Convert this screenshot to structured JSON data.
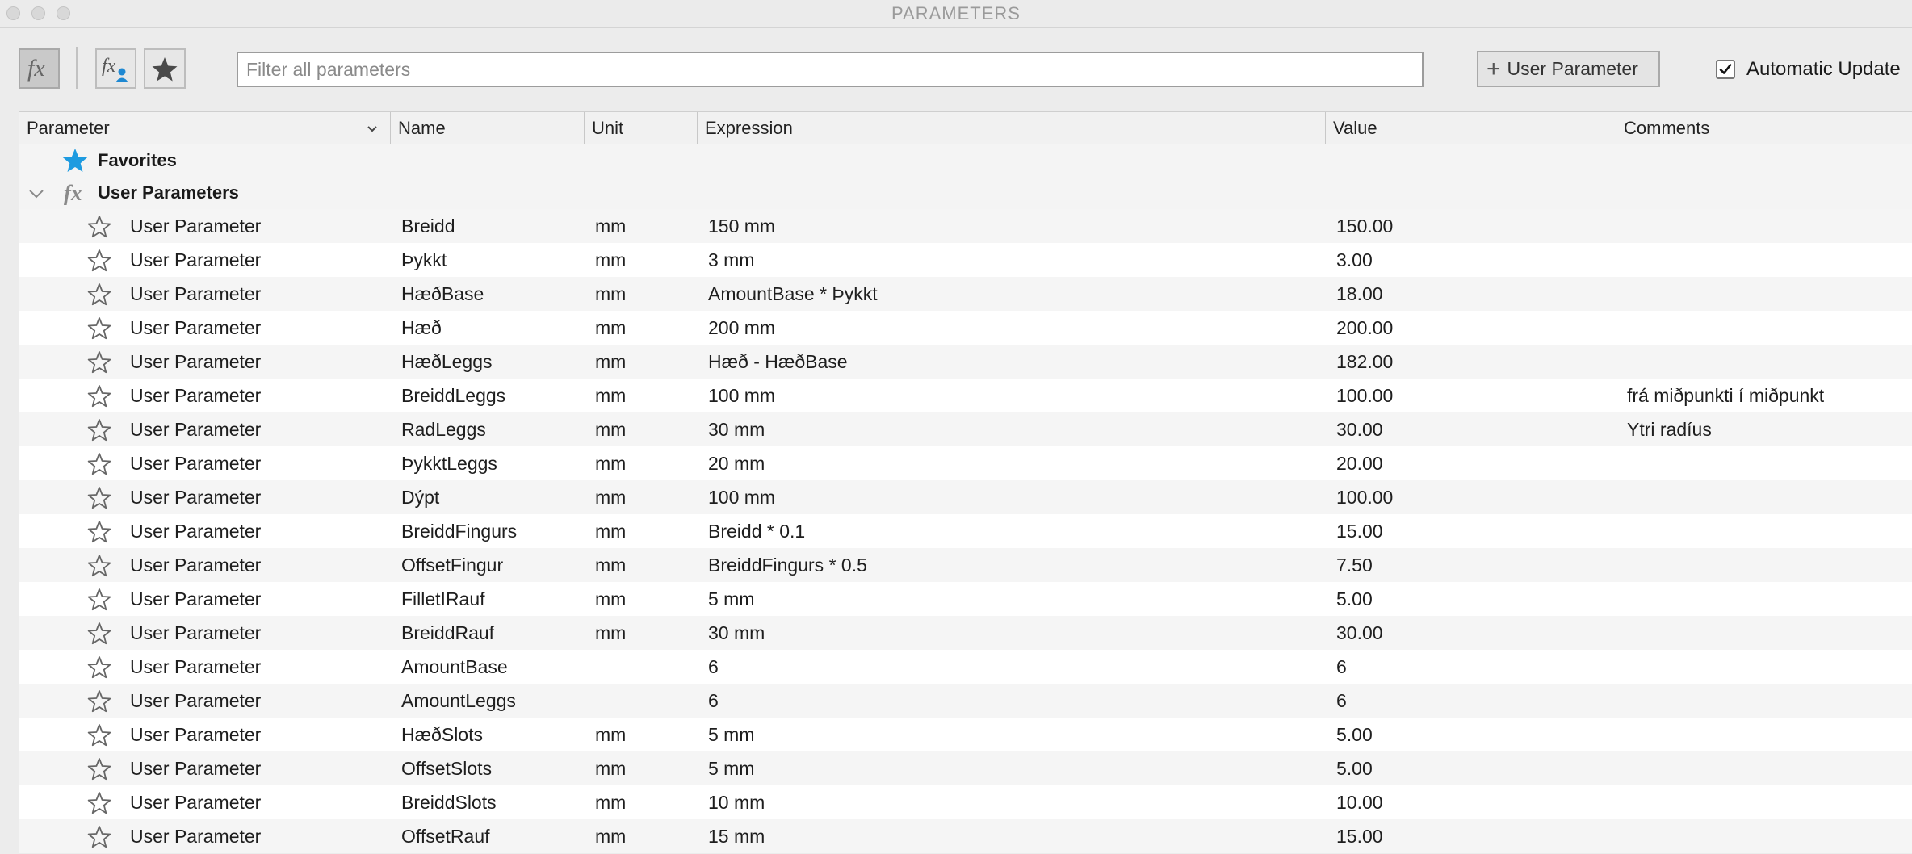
{
  "window": {
    "title": "PARAMETERS"
  },
  "toolbar": {
    "filter_placeholder": "Filter all parameters",
    "add_user_parameter_label": "User Parameter",
    "automatic_update_label": "Automatic Update",
    "automatic_update_checked": true
  },
  "columns": {
    "parameter": "Parameter",
    "name": "Name",
    "unit": "Unit",
    "expression": "Expression",
    "value": "Value",
    "comments": "Comments"
  },
  "groups": {
    "favorites": "Favorites",
    "user_parameters": "User Parameters"
  },
  "rows": [
    {
      "type": "User Parameter",
      "name": "Breidd",
      "unit": "mm",
      "expression": "150 mm",
      "value": "150.00",
      "comment": ""
    },
    {
      "type": "User Parameter",
      "name": "Þykkt",
      "unit": "mm",
      "expression": "3 mm",
      "value": "3.00",
      "comment": ""
    },
    {
      "type": "User Parameter",
      "name": "HæðBase",
      "unit": "mm",
      "expression": "AmountBase * Þykkt",
      "value": "18.00",
      "comment": ""
    },
    {
      "type": "User Parameter",
      "name": "Hæð",
      "unit": "mm",
      "expression": "200 mm",
      "value": "200.00",
      "comment": ""
    },
    {
      "type": "User Parameter",
      "name": "HæðLeggs",
      "unit": "mm",
      "expression": "Hæð - HæðBase",
      "value": "182.00",
      "comment": ""
    },
    {
      "type": "User Parameter",
      "name": "BreiddLeggs",
      "unit": "mm",
      "expression": "100 mm",
      "value": "100.00",
      "comment": "frá miðpunkti í miðpunkt"
    },
    {
      "type": "User Parameter",
      "name": "RadLeggs",
      "unit": "mm",
      "expression": "30 mm",
      "value": "30.00",
      "comment": "Ytri radíus"
    },
    {
      "type": "User Parameter",
      "name": "ÞykktLeggs",
      "unit": "mm",
      "expression": "20 mm",
      "value": "20.00",
      "comment": ""
    },
    {
      "type": "User Parameter",
      "name": "Dýpt",
      "unit": "mm",
      "expression": "100 mm",
      "value": "100.00",
      "comment": ""
    },
    {
      "type": "User Parameter",
      "name": "BreiddFingurs",
      "unit": "mm",
      "expression": "Breidd * 0.1",
      "value": "15.00",
      "comment": ""
    },
    {
      "type": "User Parameter",
      "name": "OffsetFingur",
      "unit": "mm",
      "expression": "BreiddFingurs * 0.5",
      "value": "7.50",
      "comment": ""
    },
    {
      "type": "User Parameter",
      "name": "FilletIRauf",
      "unit": "mm",
      "expression": "5 mm",
      "value": "5.00",
      "comment": ""
    },
    {
      "type": "User Parameter",
      "name": "BreiddRauf",
      "unit": "mm",
      "expression": "30 mm",
      "value": "30.00",
      "comment": ""
    },
    {
      "type": "User Parameter",
      "name": "AmountBase",
      "unit": "",
      "expression": "6",
      "value": "6",
      "comment": ""
    },
    {
      "type": "User Parameter",
      "name": "AmountLeggs",
      "unit": "",
      "expression": "6",
      "value": "6",
      "comment": ""
    },
    {
      "type": "User Parameter",
      "name": "HæðSlots",
      "unit": "mm",
      "expression": "5 mm",
      "value": "5.00",
      "comment": ""
    },
    {
      "type": "User Parameter",
      "name": "OffsetSlots",
      "unit": "mm",
      "expression": "5 mm",
      "value": "5.00",
      "comment": ""
    },
    {
      "type": "User Parameter",
      "name": "BreiddSlots",
      "unit": "mm",
      "expression": "10 mm",
      "value": "10.00",
      "comment": ""
    },
    {
      "type": "User Parameter",
      "name": "OffsetRauf",
      "unit": "mm",
      "expression": "15 mm",
      "value": "15.00",
      "comment": ""
    }
  ],
  "colors": {
    "favorites_star": "#1e9be0"
  }
}
